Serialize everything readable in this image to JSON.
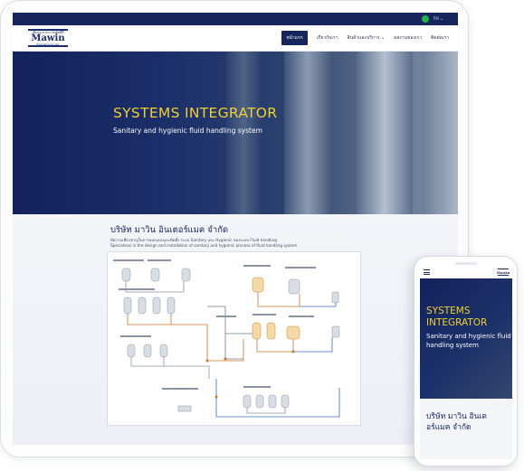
{
  "topbar": {
    "line_icon": "line-app-icon",
    "language": "TH ⌄"
  },
  "logo": {
    "top_text": "เพื่อกระบวนการผลิตที่ดี",
    "word": "Mawin",
    "sub_text": "Engineering Co.,Ltd."
  },
  "nav": {
    "items": [
      {
        "label": "หน้าแรก",
        "active": true
      },
      {
        "label": "เกี่ยวกับเรา",
        "active": false
      },
      {
        "label": "สินค้าและบริการ ⌄",
        "active": false
      },
      {
        "label": "ผลงานของเรา",
        "active": false
      },
      {
        "label": "ติดต่อเรา",
        "active": false
      }
    ]
  },
  "hero": {
    "title": "SYSTEMS INTEGRATOR",
    "subtitle": "Sanitary and hygienic fluid handling system"
  },
  "about": {
    "title": "บริษัท มาวิน อินเตอร์แมค จำกัด",
    "line1": "มีความเชี่ยวชาญในการออกแบบและติดตั้ง ระบบ Sanitary และ Hygienic ของระบบ Fluid handling",
    "line2": "Specialises in the design and installation of sanitary and hygienic process of fluid handling system"
  },
  "phone": {
    "hero_title": "SYSTEMS INTEGRATOR",
    "hero_subtitle": "Sanitary and hygienic fluid handling system",
    "about_title": "บริษัท มาวิน อินเตอร์แมค จำกัด"
  },
  "colors": {
    "navy": "#16265c",
    "accent_yellow": "#f2cf32",
    "line_green": "#22b14c"
  }
}
